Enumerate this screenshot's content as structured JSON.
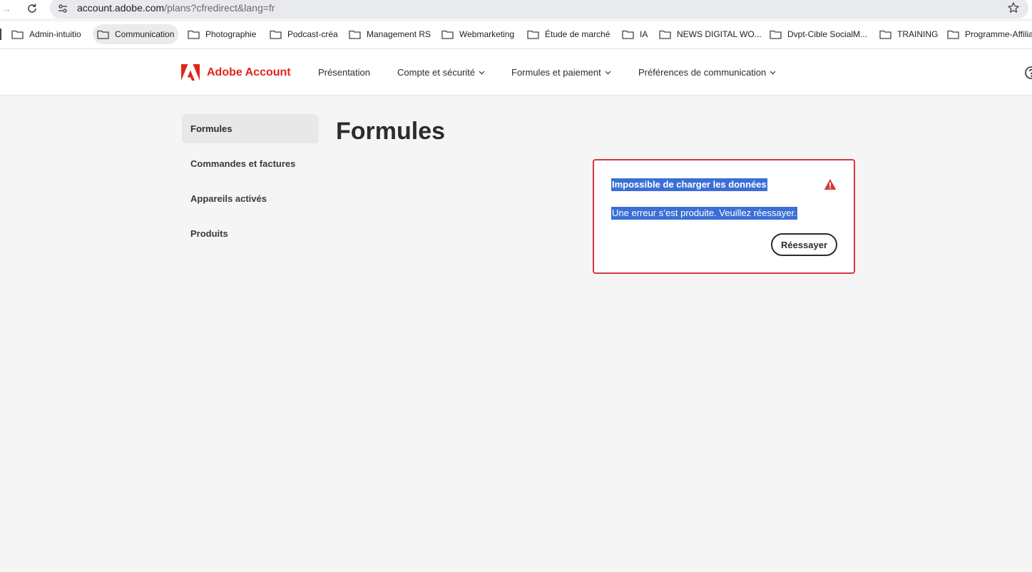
{
  "browser": {
    "url_host": "account.adobe.com",
    "url_path": "/plans?cfredirect&lang=fr",
    "bookmarks": [
      {
        "label": "Admin-intuitio"
      },
      {
        "label": "Communication"
      },
      {
        "label": "Photographie"
      },
      {
        "label": "Podcast-créa"
      },
      {
        "label": "Management RS"
      },
      {
        "label": "Webmarketing"
      },
      {
        "label": "Étude de marché"
      },
      {
        "label": "IA"
      },
      {
        "label": "NEWS DIGITAL WO..."
      },
      {
        "label": "Dvpt-Cible SocialM..."
      },
      {
        "label": "TRAINING"
      },
      {
        "label": "Programme-Affilia"
      }
    ]
  },
  "header": {
    "brand": "Adobe Account",
    "brand_color": "#e1251b",
    "nav": [
      {
        "label": "Présentation",
        "has_dropdown": false
      },
      {
        "label": "Compte et sécurité",
        "has_dropdown": true
      },
      {
        "label": "Formules et paiement",
        "has_dropdown": true
      },
      {
        "label": "Préférences de communication",
        "has_dropdown": true
      }
    ]
  },
  "sidebar": {
    "items": [
      {
        "label": "Formules",
        "selected": true
      },
      {
        "label": "Commandes et factures",
        "selected": false
      },
      {
        "label": "Appareils activés",
        "selected": false
      },
      {
        "label": "Produits",
        "selected": false
      }
    ]
  },
  "main": {
    "title": "Formules",
    "error": {
      "title": "Impossible de charger les données",
      "message": "Une erreur s’est produite. Veuillez réessayer.",
      "retry_label": "Réessayer",
      "border_color": "#d7373f",
      "selection_color": "#3b6fd6"
    }
  }
}
